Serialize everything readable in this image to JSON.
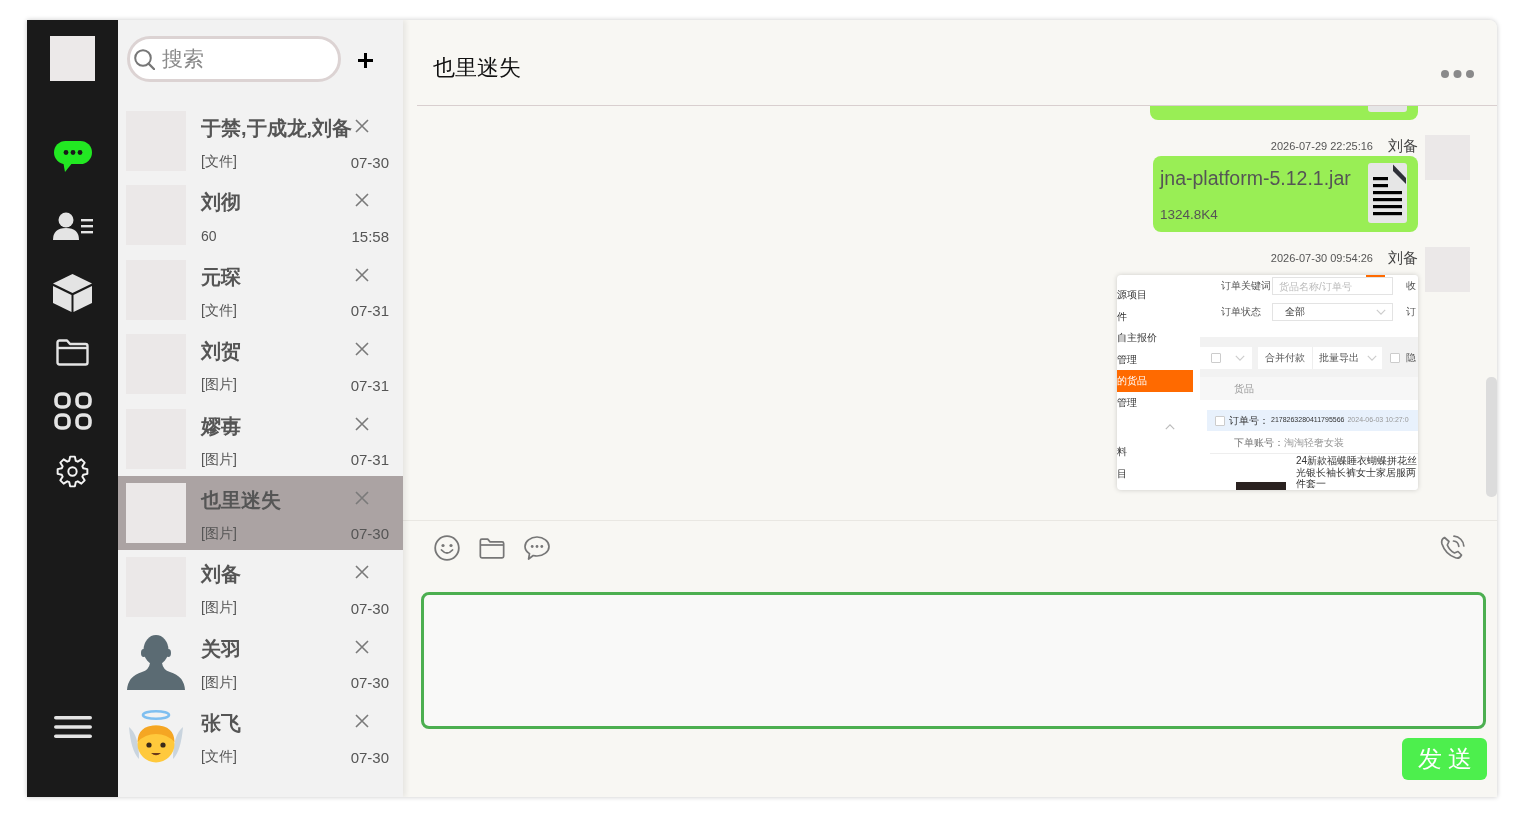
{
  "sidebar": {
    "items": [
      {
        "kind": "chat",
        "selected": true
      },
      {
        "kind": "contacts",
        "selected": false
      },
      {
        "kind": "cube",
        "selected": false
      },
      {
        "kind": "folder",
        "selected": false
      },
      {
        "kind": "apps",
        "selected": false
      },
      {
        "kind": "settings",
        "selected": false
      }
    ]
  },
  "search": {
    "placeholder": "搜索"
  },
  "contacts": [
    {
      "name": "于禁,于成龙,刘备",
      "preview": "[文件]",
      "time": "07-30",
      "avatar": {
        "kind": "photo"
      },
      "selected": false
    },
    {
      "name": "刘彻",
      "preview": "60",
      "time": "15:58",
      "avatar": {
        "kind": "photo"
      },
      "selected": false
    },
    {
      "name": "元琛",
      "preview": "[文件]",
      "time": "07-31",
      "avatar": {
        "kind": "photo"
      },
      "selected": false
    },
    {
      "name": "刘贺",
      "preview": "[图片]",
      "time": "07-31",
      "avatar": {
        "kind": "photo"
      },
      "selected": false
    },
    {
      "name": "嫪毐",
      "preview": "[图片]",
      "time": "07-31",
      "avatar": {
        "kind": "photo"
      },
      "selected": false
    },
    {
      "name": "也里迷失",
      "preview": "[图片]",
      "time": "07-30",
      "avatar": {
        "kind": "photo"
      },
      "selected": true
    },
    {
      "name": "刘备",
      "preview": "[图片]",
      "time": "07-30",
      "avatar": {
        "kind": "photo"
      },
      "selected": false
    },
    {
      "name": "关羽",
      "preview": "[图片]",
      "time": "07-30",
      "avatar": {
        "kind": "silhouette"
      },
      "selected": false
    },
    {
      "name": "张飞",
      "preview": "[文件]",
      "time": "07-30",
      "avatar": {
        "kind": "angel"
      },
      "selected": false
    }
  ],
  "chat": {
    "title": "也里迷失",
    "messages": [
      {
        "kind": "clipped"
      },
      {
        "kind": "file",
        "time": "2026-07-29 22:25:16",
        "sender": "刘备",
        "filename": "jna-platform-5.12.1.jar",
        "size": "1324.8K4"
      },
      {
        "kind": "image",
        "time": "2026-07-30 09:54:26",
        "sender": "刘备",
        "screenshot": {
          "menu_groups": [
            {
              "items": [
                {
                  "label": "源项目",
                  "selected": false
                },
                {
                  "label": "件",
                  "selected": false
                },
                {
                  "label": "自主报价",
                  "selected": false
                },
                {
                  "label": "管理",
                  "selected": false
                },
                {
                  "label": "的货品",
                  "selected": true
                },
                {
                  "label": "管理",
                  "selected": false
                }
              ]
            },
            {
              "expanded": true,
              "items": [
                {
                  "label": "料",
                  "selected": false
                },
                {
                  "label": "目",
                  "selected": false
                }
              ]
            }
          ],
          "filters": [
            {
              "kind": "input",
              "label": "订单关键词",
              "placeholder": "货品名称/订单号",
              "next_label": "收"
            },
            {
              "kind": "select",
              "label": "订单状态",
              "value": "全部",
              "next_label": "订"
            }
          ],
          "actions": [
            {
              "kind": "select-all",
              "checked": false
            },
            {
              "kind": "button",
              "label": "合并付款"
            },
            {
              "kind": "dropdown",
              "label": "批量导出"
            },
            {
              "kind": "checkbox",
              "label": "隐",
              "checked": false
            }
          ],
          "table_header": "货品",
          "order": {
            "checked": false,
            "number_label": "订单号：",
            "number": "2178263280411795566",
            "date": "2024-06-03 10:27:0",
            "account_label": "下单账号：",
            "account": "淘淘轻奢女装",
            "product": "24新款福蝶睡衣蝴蝶拼花丝光银长袖长裤女士家居服两件套一"
          }
        }
      }
    ]
  },
  "composer": {
    "send_label": "发送"
  }
}
